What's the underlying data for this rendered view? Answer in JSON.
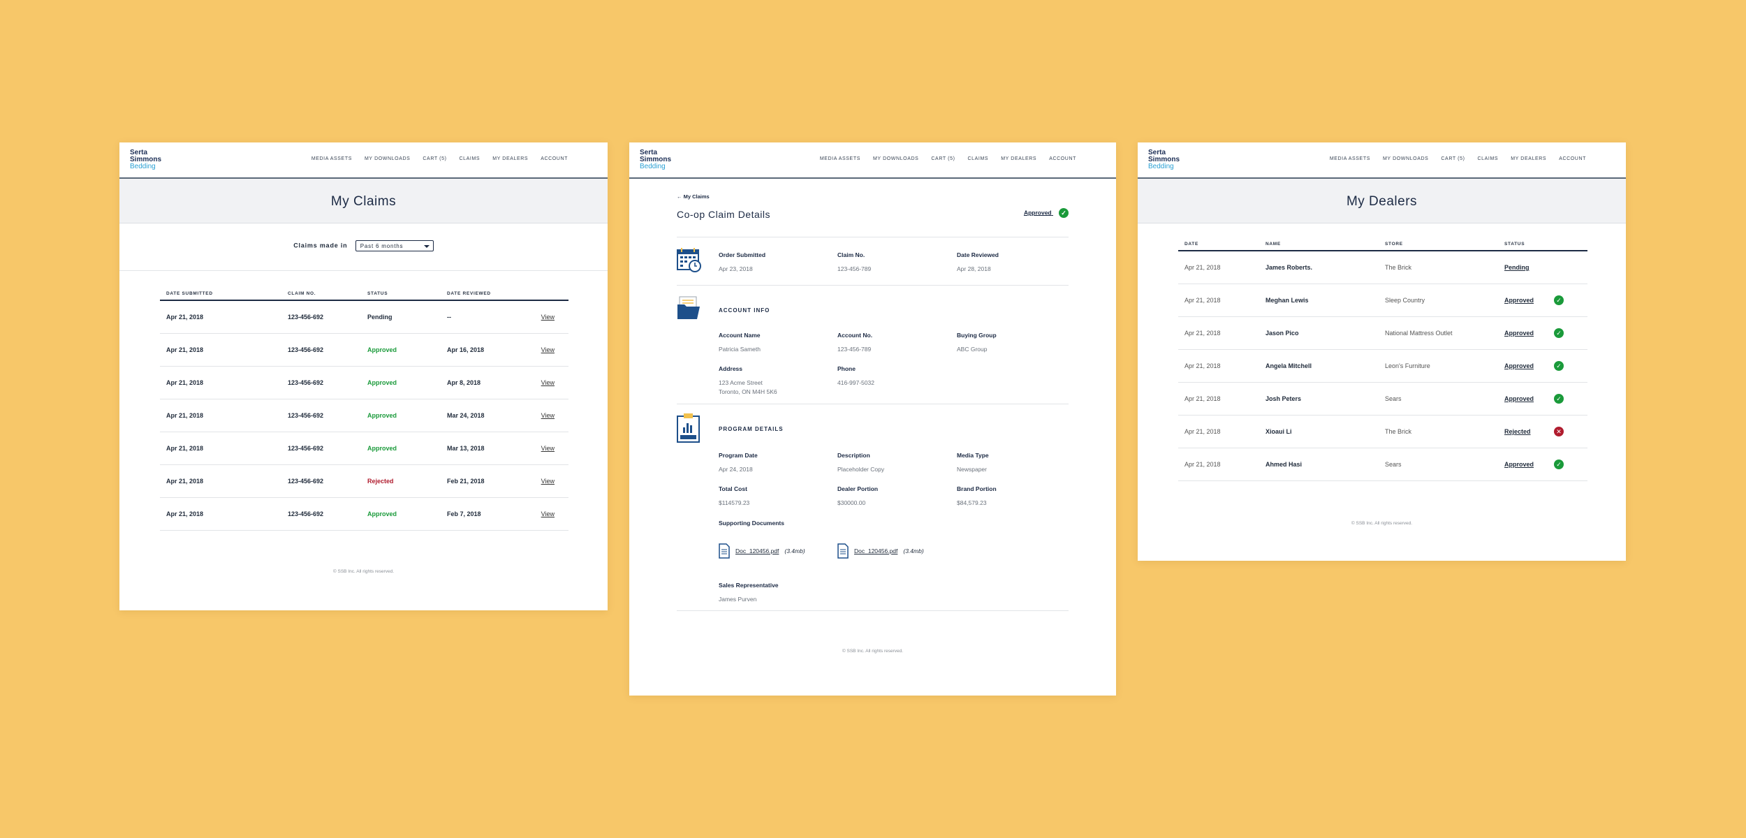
{
  "brand": {
    "line1": "Serta",
    "line2": "Simmons",
    "line3": "Bedding"
  },
  "nav": [
    "MEDIA ASSETS",
    "MY DOWNLOADS",
    "CART (5)",
    "CLAIMS",
    "MY DEALERS",
    "ACCOUNT"
  ],
  "footer": "© SSB Inc. All rights reserved.",
  "claims": {
    "title": "My Claims",
    "filter_label": "Claims made in",
    "filter_value": "Past 6 months",
    "columns": [
      "DATE SUBMITTED",
      "CLAIM NO.",
      "STATUS",
      "DATE REVIEWED",
      ""
    ],
    "rows": [
      {
        "date": "Apr 21, 2018",
        "claim": "123-456-692",
        "status": "Pending",
        "reviewed": "--",
        "action": "View"
      },
      {
        "date": "Apr 21, 2018",
        "claim": "123-456-692",
        "status": "Approved",
        "reviewed": "Apr 16, 2018",
        "action": "View"
      },
      {
        "date": "Apr 21, 2018",
        "claim": "123-456-692",
        "status": "Approved",
        "reviewed": "Apr 8, 2018",
        "action": "View"
      },
      {
        "date": "Apr 21, 2018",
        "claim": "123-456-692",
        "status": "Approved",
        "reviewed": "Mar 24, 2018",
        "action": "View"
      },
      {
        "date": "Apr 21, 2018",
        "claim": "123-456-692",
        "status": "Approved",
        "reviewed": "Mar 13, 2018",
        "action": "View"
      },
      {
        "date": "Apr 21, 2018",
        "claim": "123-456-692",
        "status": "Rejected",
        "reviewed": "Feb 21, 2018",
        "action": "View"
      },
      {
        "date": "Apr 21, 2018",
        "claim": "123-456-692",
        "status": "Approved",
        "reviewed": "Feb 7, 2018",
        "action": "View"
      }
    ]
  },
  "details": {
    "breadcrumb": "My Claims",
    "title": "Co-op Claim Details",
    "status": "Approved",
    "order": {
      "submitted_label": "Order Submitted",
      "submitted": "Apr 23, 2018",
      "claim_label": "Claim No.",
      "claim": "123-456-789",
      "reviewed_label": "Date Reviewed",
      "reviewed": "Apr 28, 2018"
    },
    "account": {
      "heading": "ACCOUNT INFO",
      "name_label": "Account Name",
      "name": "Patricia Sameth",
      "no_label": "Account No.",
      "no": "123-456-789",
      "group_label": "Buying Group",
      "group": "ABC Group",
      "address_label": "Address",
      "address1": "123 Acme Street",
      "address2": "Toronto, ON M4H 5K6",
      "phone_label": "Phone",
      "phone": "416-997-5032"
    },
    "program": {
      "heading": "PROGRAM DETAILS",
      "date_label": "Program Date",
      "date": "Apr 24, 2018",
      "desc_label": "Description",
      "desc": "Placeholder Copy",
      "media_label": "Media Type",
      "media": "Newspaper",
      "cost_label": "Total Cost",
      "cost": "$114579.23",
      "dealer_label": "Dealer Portion",
      "dealer": "$30000.00",
      "brand_label": "Brand Portion",
      "brand": "$84,579.23",
      "docs_label": "Supporting Documents",
      "docs": [
        {
          "name": "Doc_120456.pdf",
          "size": "(3.4mb)"
        },
        {
          "name": "Doc_120456.pdf",
          "size": "(3.4mb)"
        }
      ],
      "rep_label": "Sales Representative",
      "rep": "James Purven"
    }
  },
  "dealers": {
    "title": "My Dealers",
    "columns": [
      "DATE",
      "NAME",
      "STORE",
      "STATUS",
      ""
    ],
    "rows": [
      {
        "date": "Apr 21, 2018",
        "name": "James Roberts.",
        "store": "The Brick",
        "status": "Pending"
      },
      {
        "date": "Apr 21, 2018",
        "name": "Meghan Lewis",
        "store": "Sleep Country",
        "status": "Approved"
      },
      {
        "date": "Apr 21, 2018",
        "name": "Jason Pico",
        "store": "National Mattress Outlet",
        "status": "Approved"
      },
      {
        "date": "Apr 21, 2018",
        "name": "Angela Mitchell",
        "store": "Leon's Furniture",
        "status": "Approved"
      },
      {
        "date": "Apr 21, 2018",
        "name": "Josh Peters",
        "store": "Sears",
        "status": "Approved"
      },
      {
        "date": "Apr 21, 2018",
        "name": "Xioaui Li",
        "store": "The Brick",
        "status": "Rejected"
      },
      {
        "date": "Apr 21, 2018",
        "name": "Ahmed Hasi",
        "store": "Sears",
        "status": "Approved"
      }
    ]
  },
  "colors": {
    "background": "#f7c769",
    "approved": "#1a9a3a",
    "rejected": "#b01c2e",
    "navy": "#1c2a44",
    "brand_blue": "#2aa0d4"
  }
}
